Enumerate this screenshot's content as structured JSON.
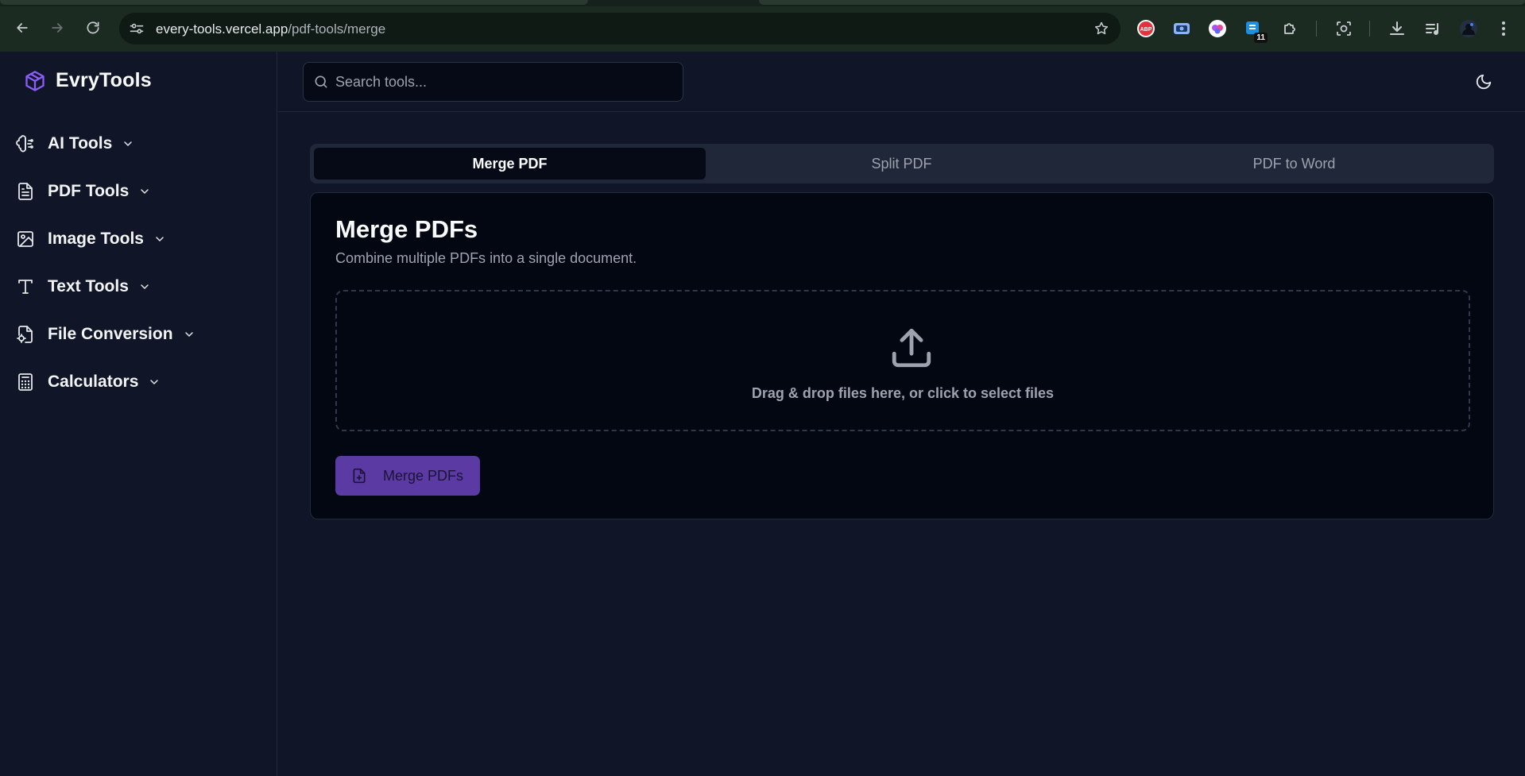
{
  "browser": {
    "url_host": "every-tools.vercel.app",
    "url_path": "/pdf-tools/merge",
    "extensions": [
      {
        "name": "adblock-plus",
        "label": "ABP"
      },
      {
        "name": "screen-capture"
      },
      {
        "name": "brain-extension"
      },
      {
        "name": "reader-extension",
        "badge": "11"
      },
      {
        "name": "extensions-puzzle"
      },
      {
        "name": "screenshot-lens"
      },
      {
        "name": "downloads"
      },
      {
        "name": "media-queue"
      },
      {
        "name": "profile-avatar"
      }
    ]
  },
  "brand": {
    "name": "EvryTools",
    "accent": "#8b5cf6"
  },
  "sidebar": {
    "items": [
      {
        "label": "AI Tools",
        "icon": "brain-icon"
      },
      {
        "label": "PDF Tools",
        "icon": "file-text-icon"
      },
      {
        "label": "Image Tools",
        "icon": "image-icon"
      },
      {
        "label": "Text Tools",
        "icon": "type-icon"
      },
      {
        "label": "File Conversion",
        "icon": "file-cog-icon"
      },
      {
        "label": "Calculators",
        "icon": "calculator-icon"
      }
    ]
  },
  "search": {
    "placeholder": "Search tools..."
  },
  "tabs": [
    {
      "label": "Merge PDF",
      "active": true
    },
    {
      "label": "Split PDF",
      "active": false
    },
    {
      "label": "PDF to Word",
      "active": false
    }
  ],
  "card": {
    "title": "Merge PDFs",
    "subtitle": "Combine multiple PDFs into a single document.",
    "dropzone_text": "Drag & drop files here, or click to select files",
    "button_label": "Merge PDFs"
  },
  "colors": {
    "page_bg": "#101627",
    "card_bg": "#030712",
    "button_bg": "#5b3aa3",
    "muted_text": "#9ca3af"
  }
}
